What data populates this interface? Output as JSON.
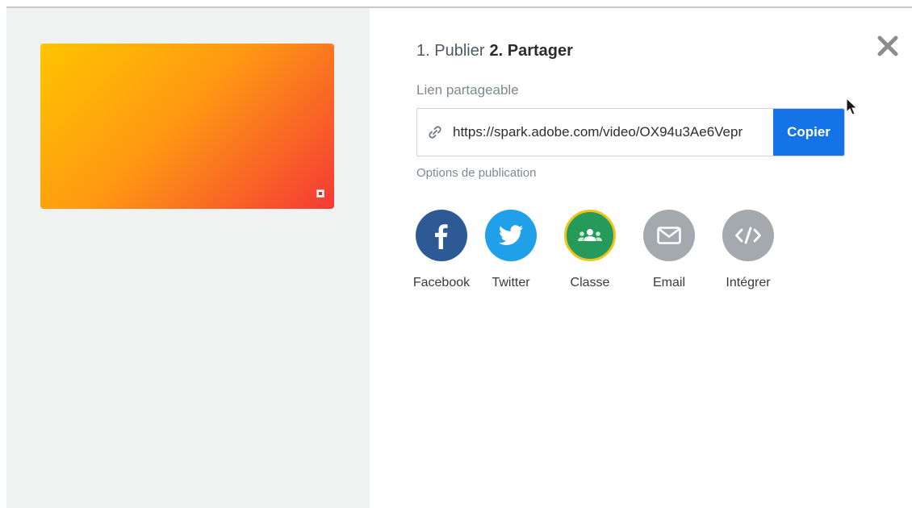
{
  "steps": {
    "step1": "1. Publier",
    "step2": "2. Partager"
  },
  "share_link": {
    "label": "Lien partageable",
    "url": "https://spark.adobe.com/video/OX94u3Ae6Vepr",
    "copy_label": "Copier",
    "link_icon": "link-icon"
  },
  "options": {
    "label": "Options de publication"
  },
  "share_targets": [
    {
      "label": "Facebook",
      "icon": "facebook-icon",
      "color": "#2d5a94"
    },
    {
      "label": "Twitter",
      "icon": "twitter-icon",
      "color": "#1fa0e8"
    },
    {
      "label": "Classe",
      "icon": "google-classroom-icon",
      "color": "#269a5a"
    },
    {
      "label": "Email",
      "icon": "envelope-icon",
      "color": "#a4a9ae"
    },
    {
      "label": "Intégrer",
      "icon": "code-embed-icon",
      "color": "#a4a9ae"
    }
  ],
  "colors": {
    "accent": "#1473e6",
    "left_panel": "#f0f1f1"
  }
}
